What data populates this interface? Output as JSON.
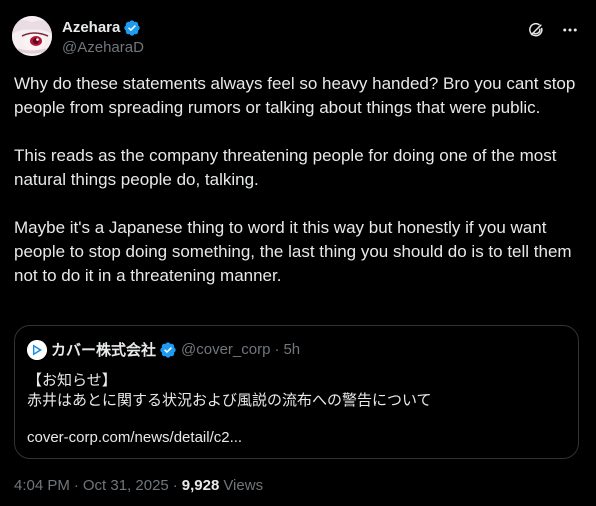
{
  "author": {
    "display_name": "Azehara",
    "handle": "@AzeharaD",
    "verified": true
  },
  "actions": {
    "grok_icon": "grok-icon",
    "more_icon": "more-icon"
  },
  "body": {
    "paragraphs": [
      "Why do these statements always feel so heavy handed?  Bro you cant stop people from spreading rumors or talking about things that were public.",
      "This reads as the company threatening people for doing one of the most natural things people do, talking.",
      "Maybe it's a Japanese thing to word it this way but honestly if you want people to stop doing something, the last thing you should do is to tell them not to do it in a threatening manner."
    ]
  },
  "quoted": {
    "display_name": "カバー株式会社",
    "handle": "@cover_corp",
    "separator": "·",
    "time": "5h",
    "verified": true,
    "lines": [
      "【お知らせ】",
      "赤井はあとに関する状況および風説の流布への警告について"
    ],
    "link": "cover-corp.com/news/detail/c2..."
  },
  "meta": {
    "time": "4:04 PM",
    "date": "Oct 31, 2025",
    "separator": "·",
    "views_count": "9,928",
    "views_label": "Views"
  },
  "colors": {
    "background": "#000000",
    "text": "#e7e9ea",
    "secondary": "#71767b",
    "border": "#2f3336",
    "verified": "#1d9bf0"
  }
}
